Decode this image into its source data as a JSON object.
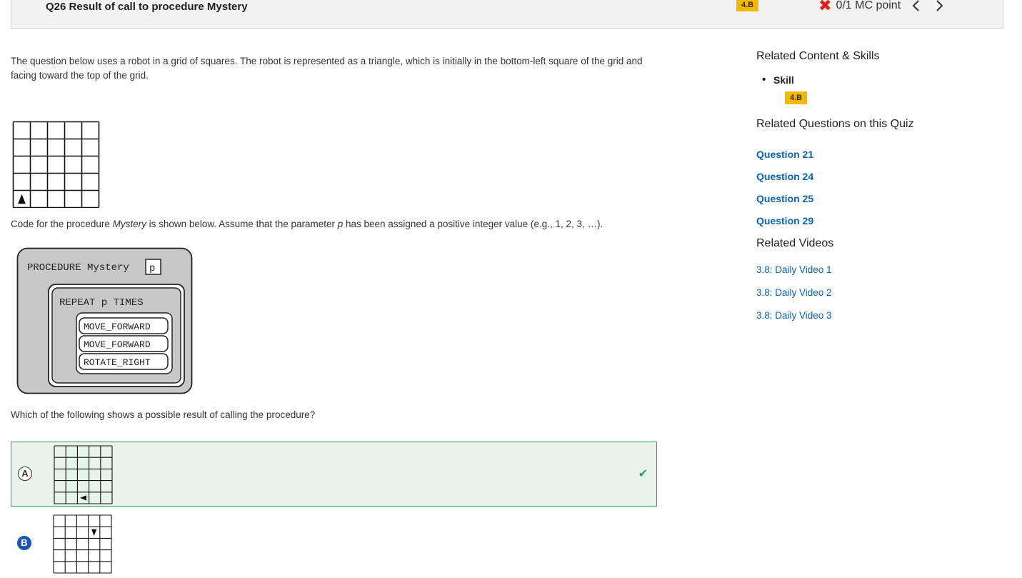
{
  "header": {
    "question_title": "Q26 Result of call to procedure Mystery",
    "skill_badge": "4.B",
    "score": "0/1 MC point",
    "prev_icon": "chevron-left-icon",
    "next_icon": "chevron-right-icon",
    "incorrect_icon": "x-mark-icon"
  },
  "question": {
    "intro": "The question below uses a robot in a grid of squares. The robot is represented as a triangle, which is initially in the bottom-left square of the grid and facing toward the top of the grid.",
    "code_text_pre": "Code for the procedure ",
    "code_text_proc": "Mystery",
    "code_text_mid": " is shown below. Assume that the parameter ",
    "code_text_param": "p",
    "code_text_post": " has been assigned a positive integer value (e.g., 1, 2, 3, …).",
    "procedure": {
      "header": "PROCEDURE Mystery",
      "param": "p",
      "repeat": "REPEAT p TIMES",
      "steps": [
        "MOVE_FORWARD",
        "MOVE_FORWARD",
        "ROTATE_RIGHT"
      ]
    },
    "prompt": "Which of the following shows a possible result of calling the procedure?"
  },
  "answers": [
    {
      "letter": "A",
      "correct": true,
      "robot": {
        "row": 4,
        "col": 2,
        "dir": "left"
      }
    },
    {
      "letter": "B",
      "correct": false,
      "robot": {
        "row": 1,
        "col": 3,
        "dir": "down"
      }
    }
  ],
  "initial_grid": {
    "rows": 5,
    "cols": 5,
    "robot": {
      "row": 4,
      "col": 0,
      "dir": "up"
    }
  },
  "sidebar": {
    "related_content_heading": "Related Content & Skills",
    "skill_label": "Skill",
    "skill_badge": "4.B",
    "related_questions_heading": "Related Questions on this Quiz",
    "related_questions": [
      "Question 21",
      "Question 24",
      "Question 25",
      "Question 29"
    ],
    "related_videos_heading": "Related Videos",
    "related_videos": [
      "3.8: Daily Video 1",
      "3.8: Daily Video 2",
      "3.8: Daily Video 3"
    ]
  },
  "colors": {
    "badge": "#f5b800",
    "link": "#0a62b8",
    "correct_bg": "#e6f4ec",
    "correct_border": "#2fa05a",
    "incorrect": "#e0201b",
    "selected_choice": "#1f56b5"
  }
}
